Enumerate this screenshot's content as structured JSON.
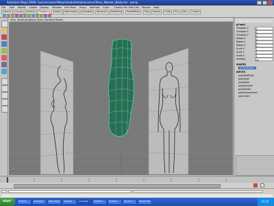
{
  "title": "Autodesk Maya 2008: \\\\server\\users\\Maya\\shadeAkimbo\\scenes\\Torso_Woman_Body.mb - persp",
  "menu": [
    "File",
    "Edit",
    "Modify",
    "Create",
    "Display",
    "Window",
    "Edit Mesh",
    "Proxy",
    "Normals",
    "Color",
    "Create UVs",
    "Edit UVs",
    "Muscle",
    "Help"
  ],
  "shelf_tabs": [
    "General",
    "Curves",
    "Surfaces",
    "Polygons",
    "Subdivs",
    "Deformation",
    "Animation",
    "Dynamics",
    "Rendering",
    "PaintEffects",
    "Toon",
    "Muscle",
    "Fluids",
    "Fur",
    "Hair",
    "Custom"
  ],
  "panel_menu": [
    "View",
    "Shading",
    "Lighting",
    "Show",
    "Renderer",
    "Panels"
  ],
  "channel_box": {
    "object": "pCube1",
    "channels": [
      {
        "name": "Translate X",
        "value": "0"
      },
      {
        "name": "Translate Y",
        "value": "0"
      },
      {
        "name": "Translate Z",
        "value": "0"
      },
      {
        "name": "Rotate X",
        "value": "0"
      },
      {
        "name": "Rotate Y",
        "value": "0"
      },
      {
        "name": "Rotate Z",
        "value": "0"
      },
      {
        "name": "Scale X",
        "value": "1"
      },
      {
        "name": "Scale Y",
        "value": "1"
      },
      {
        "name": "Scale Z",
        "value": "1"
      },
      {
        "name": "Visibility",
        "value": "on"
      }
    ],
    "shapes_label": "SHAPES",
    "shape": "pCubeShape1",
    "inputs_label": "INPUTS",
    "inputs": [
      "polySplitRing1",
      "polySplit5",
      "polySplit4",
      "polyExtrude3",
      "polyTweak1",
      "polyExtrudeFace1",
      "polyCube1"
    ]
  },
  "taskbar": {
    "start": "start",
    "buttons": [
      "3 Wind...",
      "Autodesk",
      "Maya Help",
      "Untitled",
      "Autodesk",
      "Untitled",
      "Untitled",
      "My Docs",
      "Output Win"
    ],
    "clock": "10:25"
  },
  "colors": {
    "viewport": "#7a7a7a",
    "wire": "#3de08a",
    "mesh": "#2a6f5a",
    "titlebar": "#2f56b6"
  }
}
